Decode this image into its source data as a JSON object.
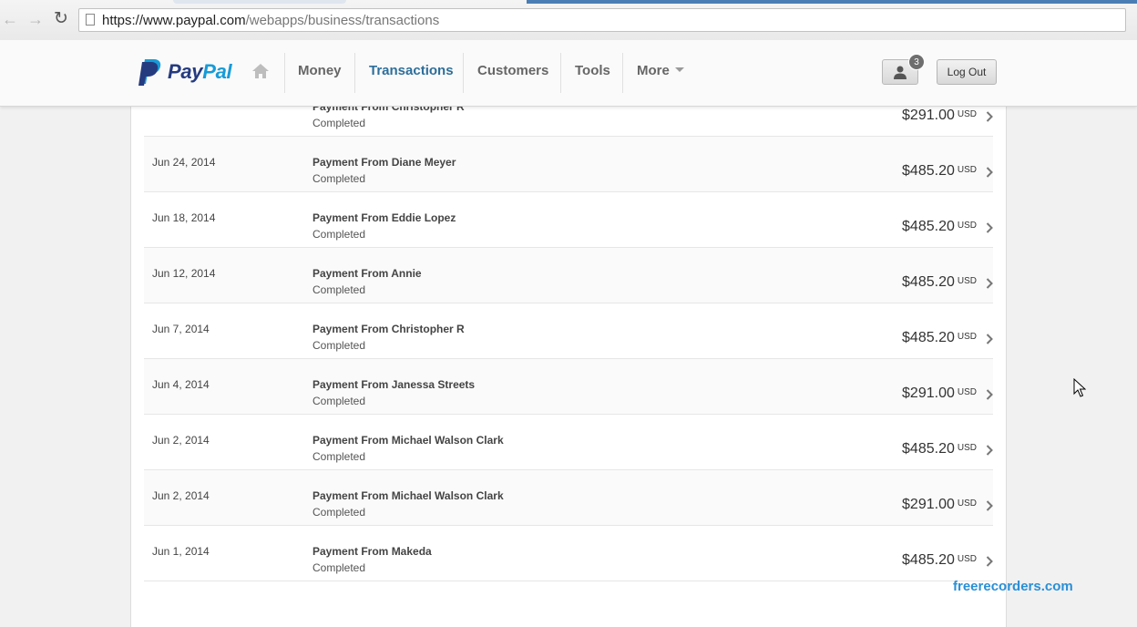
{
  "browser": {
    "url_host": "https://www.paypal.com",
    "url_path": "/webapps/business/transactions"
  },
  "header": {
    "logo_pay": "Pay",
    "logo_pal": "Pal",
    "nav": {
      "money": "Money",
      "transactions": "Transactions",
      "customers": "Customers",
      "tools": "Tools",
      "more": "More"
    },
    "notification_count": "3",
    "logout_label": "Log Out"
  },
  "transactions": [
    {
      "date": "",
      "desc": "Payment From Christopher R",
      "status": "Completed",
      "amount": "$291.00",
      "currency": "USD"
    },
    {
      "date": "Jun 24, 2014",
      "desc": "Payment From Diane Meyer",
      "status": "Completed",
      "amount": "$485.20",
      "currency": "USD"
    },
    {
      "date": "Jun 18, 2014",
      "desc": "Payment From Eddie Lopez",
      "status": "Completed",
      "amount": "$485.20",
      "currency": "USD"
    },
    {
      "date": "Jun 12, 2014",
      "desc": "Payment From Annie",
      "status": "Completed",
      "amount": "$485.20",
      "currency": "USD"
    },
    {
      "date": "Jun 7, 2014",
      "desc": "Payment From Christopher R",
      "status": "Completed",
      "amount": "$485.20",
      "currency": "USD"
    },
    {
      "date": "Jun 4, 2014",
      "desc": "Payment From Janessa Streets",
      "status": "Completed",
      "amount": "$291.00",
      "currency": "USD"
    },
    {
      "date": "Jun 2, 2014",
      "desc": "Payment From Michael Walson Clark",
      "status": "Completed",
      "amount": "$485.20",
      "currency": "USD"
    },
    {
      "date": "Jun 2, 2014",
      "desc": "Payment From Michael Walson Clark",
      "status": "Completed",
      "amount": "$291.00",
      "currency": "USD"
    },
    {
      "date": "Jun 1, 2014",
      "desc": "Payment From Makeda",
      "status": "Completed",
      "amount": "$485.20",
      "currency": "USD"
    }
  ],
  "watermark": "freerecorders.com",
  "colors": {
    "brand_dark": "#253b80",
    "brand_light": "#179bd7",
    "active_nav": "#2d6e9a"
  }
}
